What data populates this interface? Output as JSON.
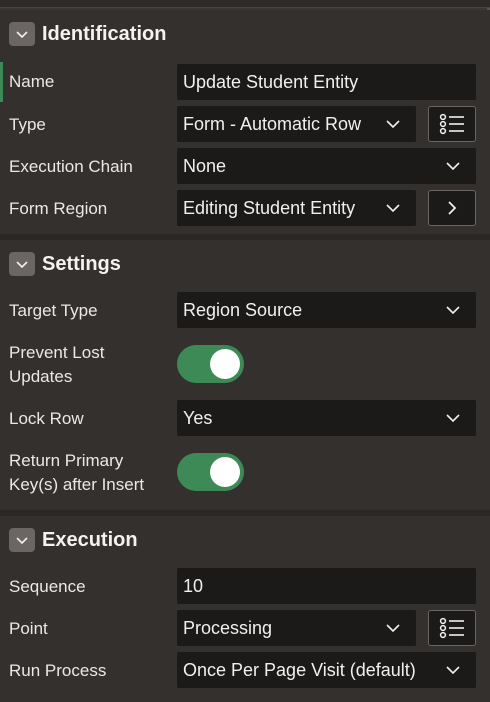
{
  "sections": {
    "identification": {
      "title": "Identification",
      "name_label": "Name",
      "name_value": "Update Student Entity",
      "type_label": "Type",
      "type_value": "Form - Automatic Row",
      "chain_label": "Execution Chain",
      "chain_value": "None",
      "region_label": "Form Region",
      "region_value": "Editing Student Entity"
    },
    "settings": {
      "title": "Settings",
      "target_label": "Target Type",
      "target_value": "Region Source",
      "prevent_label_1": "Prevent Lost",
      "prevent_label_2": "Updates",
      "prevent_on": true,
      "lock_label": "Lock Row",
      "lock_value": "Yes",
      "return_label_1": "Return Primary",
      "return_label_2": "Key(s) after Insert",
      "return_on": true
    },
    "execution": {
      "title": "Execution",
      "sequence_label": "Sequence",
      "sequence_value": "10",
      "point_label": "Point",
      "point_value": "Processing",
      "run_label": "Run Process",
      "run_value": "Once Per Page Visit (default)"
    }
  },
  "icons": {
    "collapse": "chevron-down-icon",
    "dropdown": "chevron-down-icon",
    "list": "list-icon",
    "navigate": "chevron-right-icon"
  },
  "colors": {
    "toggle_on": "#3d8a57",
    "field_bg": "#1c1a19",
    "panel_bg": "#33302e"
  }
}
